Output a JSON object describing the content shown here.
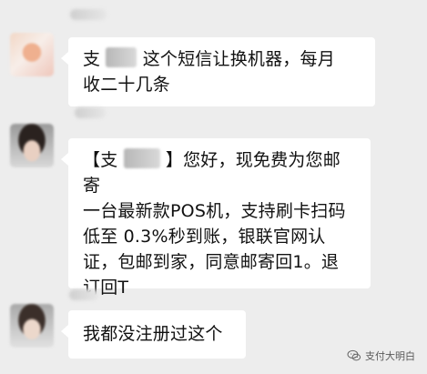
{
  "messages": [
    {
      "avatar_icon": "blurred-avatar-icon",
      "line1_prefix": "支",
      "line1_suffix": "这个短信让换机器，每月",
      "line2": "收二十几条"
    },
    {
      "avatar_icon": "blurred-avatar-icon",
      "prefix": "【支",
      "line1_suffix": "】您好，现免费为您邮寄",
      "line2": "一台最新款POS机，支持刷卡扫码",
      "line3": "低至 0.3%秒到账，银联官网认",
      "line4": "证，包邮到家，同意邮寄回1。退",
      "line5": "订回T"
    },
    {
      "avatar_icon": "blurred-avatar-icon",
      "text": "我都没注册过这个"
    }
  ],
  "watermark": {
    "icon": "wechat-icon",
    "text": "支付大明白"
  }
}
